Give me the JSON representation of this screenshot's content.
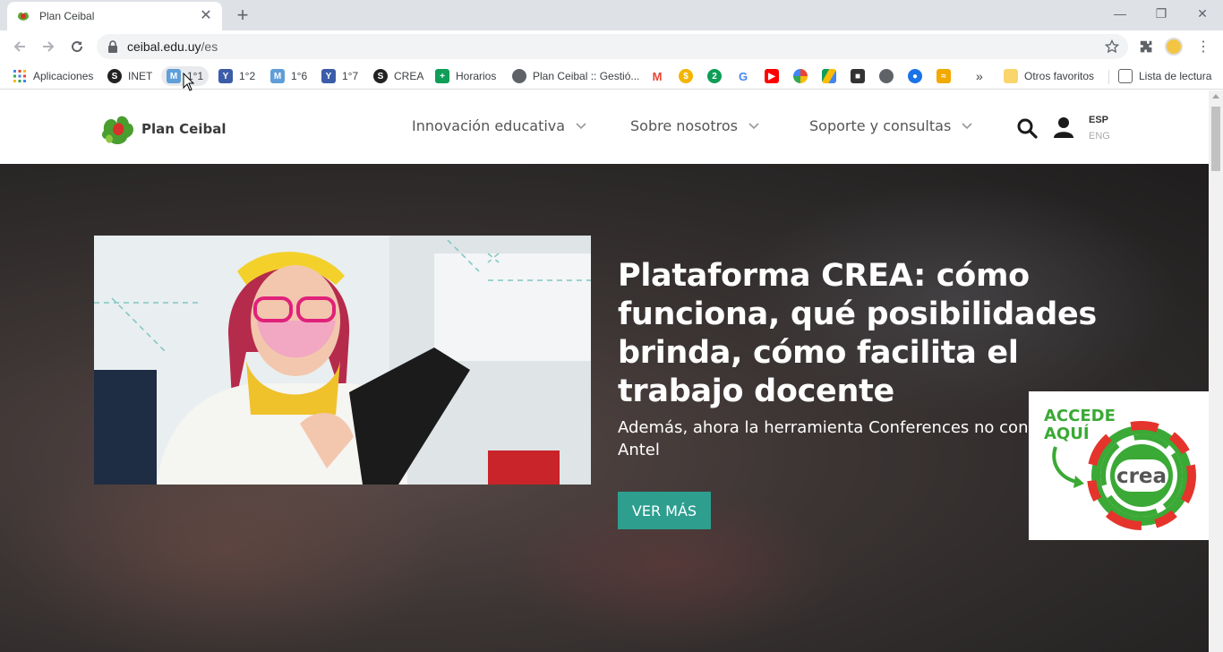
{
  "browser": {
    "tab": {
      "title": "Plan Ceibal",
      "close": "✕"
    },
    "new_tab": "+",
    "window_controls": {
      "minimize": "—",
      "restore": "❐",
      "close": "✕"
    },
    "url_host": "ceibal.edu.uy",
    "url_path": "/es"
  },
  "bookmarks": {
    "apps": "Aplicaciones",
    "items": [
      {
        "label": "INET",
        "icon": "S"
      },
      {
        "label": "1°1",
        "icon": "M"
      },
      {
        "label": "1°2",
        "icon": "Y"
      },
      {
        "label": "1°6",
        "icon": "M"
      },
      {
        "label": "1°7",
        "icon": "Y"
      },
      {
        "label": "CREA",
        "icon": "S"
      },
      {
        "label": "Horarios",
        "icon": "+"
      },
      {
        "label": "Plan Ceibal :: Gestió...",
        "icon": "globe"
      }
    ],
    "overflow": "»",
    "other": "Otros favoritos",
    "reading_list": "Lista de lectura"
  },
  "header": {
    "logo_text": "Plan Ceibal",
    "nav": [
      "Innovación educativa",
      "Sobre nosotros",
      "Soporte y consultas"
    ],
    "lang_active": "ESP",
    "lang_other": "ENG"
  },
  "hero": {
    "title": "Plataforma CREA: cómo funciona, qué posibilidades brinda, cómo facilita el trabajo docente",
    "subtitle_line1": "Además, ahora la herramienta Conferences no consume datos",
    "subtitle_line2": "Antel",
    "button": "VER MÁS"
  },
  "crea_badge": {
    "line1": "ACCEDE",
    "line2": "AQUÍ",
    "logo": "crea"
  },
  "colors": {
    "accent": "#2e9e8f",
    "crea_green": "#3aa935",
    "crea_red": "#e4342c"
  }
}
